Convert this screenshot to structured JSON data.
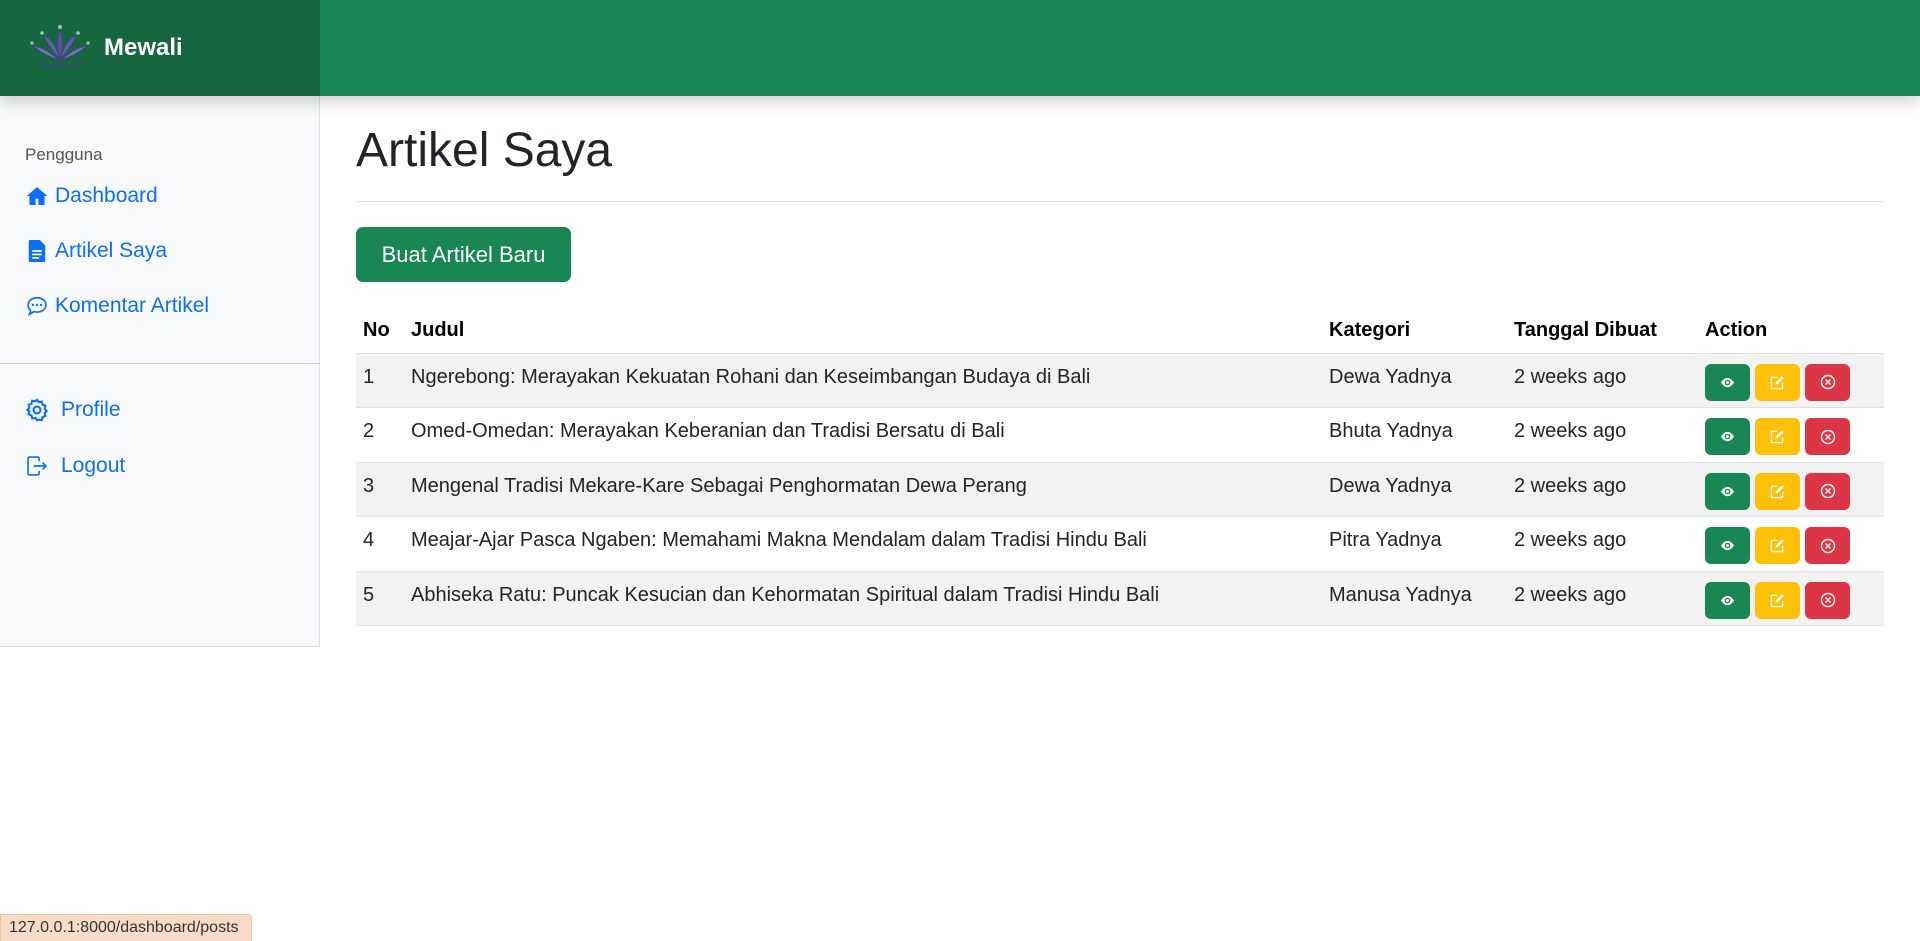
{
  "brand": {
    "name": "Mewali",
    "logo_icon": "lotus-logo-icon"
  },
  "sidebar": {
    "heading": "Pengguna",
    "items": [
      {
        "label": "Dashboard",
        "icon": "home-icon"
      },
      {
        "label": "Artikel Saya",
        "icon": "document-icon"
      },
      {
        "label": "Komentar Artikel",
        "icon": "chat-icon"
      }
    ],
    "secondary": [
      {
        "label": "Profile",
        "icon": "gear-icon"
      },
      {
        "label": "Logout",
        "icon": "logout-icon"
      }
    ]
  },
  "main": {
    "title": "Artikel Saya",
    "new_button": "Buat Artikel Baru",
    "columns": [
      "No",
      "Judul",
      "Kategori",
      "Tanggal Dibuat",
      "Action"
    ],
    "rows": [
      {
        "no": "1",
        "judul": "Ngerebong: Merayakan Kekuatan Rohani dan Keseimbangan Budaya di Bali",
        "kategori": "Dewa Yadnya",
        "tanggal": "2 weeks ago"
      },
      {
        "no": "2",
        "judul": "Omed-Omedan: Merayakan Keberanian dan Tradisi Bersatu di Bali",
        "kategori": "Bhuta Yadnya",
        "tanggal": "2 weeks ago"
      },
      {
        "no": "3",
        "judul": "Mengenal Tradisi Mekare-Kare Sebagai Penghormatan Dewa Perang",
        "kategori": "Dewa Yadnya",
        "tanggal": "2 weeks ago"
      },
      {
        "no": "4",
        "judul": "Meajar-Ajar Pasca Ngaben: Memahami Makna Mendalam dalam Tradisi Hindu Bali",
        "kategori": "Pitra Yadnya",
        "tanggal": "2 weeks ago"
      },
      {
        "no": "5",
        "judul": "Abhiseka Ratu: Puncak Kesucian dan Kehormatan Spiritual dalam Tradisi Hindu Bali",
        "kategori": "Manusa Yadnya",
        "tanggal": "2 weeks ago"
      }
    ]
  },
  "status_bar": {
    "url": "127.0.0.1:8000/dashboard/posts"
  },
  "colors": {
    "primary": "#198754",
    "brand_dark": "#166640",
    "link": "#0d6efd",
    "warning": "#ffc107",
    "danger": "#dc3545"
  }
}
